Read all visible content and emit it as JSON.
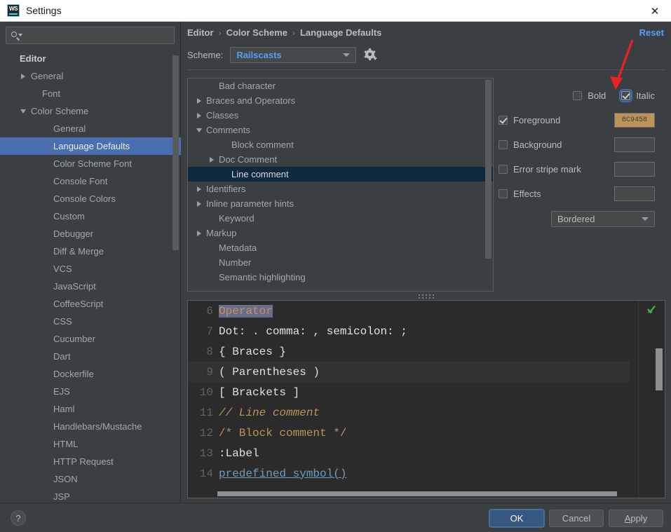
{
  "window": {
    "title": "Settings",
    "app_icon": "webstorm-logo-icon",
    "logo_text": "WS",
    "close_icon": "close-icon"
  },
  "sidebar": {
    "search": {
      "placeholder": "",
      "value": "",
      "icon": "search-icon"
    },
    "items": [
      {
        "label": "Editor",
        "indent": 0,
        "twisty": "none",
        "selected": false,
        "bold": true
      },
      {
        "label": "General",
        "indent": 1,
        "twisty": "right",
        "selected": false
      },
      {
        "label": "Font",
        "indent": 2,
        "twisty": "none",
        "selected": false
      },
      {
        "label": "Color Scheme",
        "indent": 1,
        "twisty": "down",
        "selected": false
      },
      {
        "label": "General",
        "indent": 3,
        "twisty": "none",
        "selected": false
      },
      {
        "label": "Language Defaults",
        "indent": 3,
        "twisty": "none",
        "selected": true
      },
      {
        "label": "Color Scheme Font",
        "indent": 3,
        "twisty": "none",
        "selected": false
      },
      {
        "label": "Console Font",
        "indent": 3,
        "twisty": "none",
        "selected": false
      },
      {
        "label": "Console Colors",
        "indent": 3,
        "twisty": "none",
        "selected": false
      },
      {
        "label": "Custom",
        "indent": 3,
        "twisty": "none",
        "selected": false
      },
      {
        "label": "Debugger",
        "indent": 3,
        "twisty": "none",
        "selected": false
      },
      {
        "label": "Diff & Merge",
        "indent": 3,
        "twisty": "none",
        "selected": false
      },
      {
        "label": "VCS",
        "indent": 3,
        "twisty": "none",
        "selected": false
      },
      {
        "label": "JavaScript",
        "indent": 3,
        "twisty": "none",
        "selected": false
      },
      {
        "label": "CoffeeScript",
        "indent": 3,
        "twisty": "none",
        "selected": false
      },
      {
        "label": "CSS",
        "indent": 3,
        "twisty": "none",
        "selected": false
      },
      {
        "label": "Cucumber",
        "indent": 3,
        "twisty": "none",
        "selected": false
      },
      {
        "label": "Dart",
        "indent": 3,
        "twisty": "none",
        "selected": false
      },
      {
        "label": "Dockerfile",
        "indent": 3,
        "twisty": "none",
        "selected": false
      },
      {
        "label": "EJS",
        "indent": 3,
        "twisty": "none",
        "selected": false
      },
      {
        "label": "Haml",
        "indent": 3,
        "twisty": "none",
        "selected": false
      },
      {
        "label": "Handlebars/Mustache",
        "indent": 3,
        "twisty": "none",
        "selected": false
      },
      {
        "label": "HTML",
        "indent": 3,
        "twisty": "none",
        "selected": false
      },
      {
        "label": "HTTP Request",
        "indent": 3,
        "twisty": "none",
        "selected": false
      },
      {
        "label": "JSON",
        "indent": 3,
        "twisty": "none",
        "selected": false
      },
      {
        "label": "JSP",
        "indent": 3,
        "twisty": "none",
        "selected": false
      }
    ]
  },
  "header": {
    "breadcrumb": [
      "Editor",
      "Color Scheme",
      "Language Defaults"
    ],
    "breadcrumb_separator": "›",
    "reset_label": "Reset",
    "scheme_label": "Scheme:",
    "scheme_value": "Railscasts",
    "scheme_settings_icon": "gear-icon"
  },
  "color_tree": {
    "items": [
      {
        "label": "Bad character",
        "indent": 1,
        "twisty": "none",
        "selected": false
      },
      {
        "label": "Braces and Operators",
        "indent": 0,
        "twisty": "right",
        "selected": false
      },
      {
        "label": "Classes",
        "indent": 0,
        "twisty": "right",
        "selected": false
      },
      {
        "label": "Comments",
        "indent": 0,
        "twisty": "down",
        "selected": false
      },
      {
        "label": "Block comment",
        "indent": 2,
        "twisty": "none",
        "selected": false
      },
      {
        "label": "Doc Comment",
        "indent": 1,
        "twisty": "right",
        "selected": false
      },
      {
        "label": "Line comment",
        "indent": 2,
        "twisty": "none",
        "selected": true
      },
      {
        "label": "Identifiers",
        "indent": 0,
        "twisty": "right",
        "selected": false
      },
      {
        "label": "Inline parameter hints",
        "indent": 0,
        "twisty": "right",
        "selected": false
      },
      {
        "label": "Keyword",
        "indent": 1,
        "twisty": "none",
        "selected": false
      },
      {
        "label": "Markup",
        "indent": 0,
        "twisty": "right",
        "selected": false
      },
      {
        "label": "Metadata",
        "indent": 1,
        "twisty": "none",
        "selected": false
      },
      {
        "label": "Number",
        "indent": 1,
        "twisty": "none",
        "selected": false
      },
      {
        "label": "Semantic highlighting",
        "indent": 1,
        "twisty": "none",
        "selected": false
      }
    ]
  },
  "attributes": {
    "bold": {
      "label": "Bold",
      "checked": false
    },
    "italic": {
      "label": "Italic",
      "checked": true,
      "focused": true
    },
    "foreground": {
      "label": "Foreground",
      "checked": true,
      "color": "#BC9458",
      "color_text": "BC9458"
    },
    "background": {
      "label": "Background",
      "checked": false,
      "color": ""
    },
    "error_stripe": {
      "label": "Error stripe mark",
      "checked": false,
      "color": ""
    },
    "effects": {
      "label": "Effects",
      "checked": false,
      "color": ""
    },
    "effect_type": {
      "value": "Bordered"
    }
  },
  "preview": {
    "lines": [
      {
        "num": "6",
        "highlighted": false,
        "tokens": [
          {
            "text": "Operator",
            "style": "sel"
          }
        ]
      },
      {
        "num": "7",
        "highlighted": false,
        "tokens": [
          {
            "text": "Dot: . comma: , semicolon: ;",
            "style": "def"
          }
        ]
      },
      {
        "num": "8",
        "highlighted": false,
        "tokens": [
          {
            "text": "{ Braces }",
            "style": "def"
          }
        ]
      },
      {
        "num": "9",
        "highlighted": true,
        "tokens": [
          {
            "text": "( Parentheses )",
            "style": "def"
          }
        ]
      },
      {
        "num": "10",
        "highlighted": false,
        "tokens": [
          {
            "text": "[ Brackets ]",
            "style": "def"
          }
        ]
      },
      {
        "num": "11",
        "highlighted": false,
        "tokens": [
          {
            "text": "// Line comment",
            "style": "comment"
          }
        ]
      },
      {
        "num": "12",
        "highlighted": false,
        "tokens": [
          {
            "text": "/* Block comment */",
            "style": "block"
          }
        ]
      },
      {
        "num": "13",
        "highlighted": false,
        "tokens": [
          {
            "text": ":Label",
            "style": "def"
          }
        ]
      },
      {
        "num": "14",
        "highlighted": false,
        "tokens": [
          {
            "text": "predefined_symbol()",
            "style": "predef"
          }
        ]
      }
    ],
    "inspection_icon": "inspection-ok-checkmark-icon"
  },
  "footer": {
    "help_label": "?",
    "ok_label": "OK",
    "cancel_label": "Cancel",
    "apply_label": "Apply",
    "apply_mnemonic": "A",
    "apply_rest": "pply"
  },
  "annotation": {
    "arrow_color": "#ED2024",
    "points_to": "italic-checkbox"
  },
  "colors": {
    "accent_blue": "#589df6",
    "selection_blue": "#4b6eaf",
    "tree_selection": "#0d293e",
    "panel_bg": "#3c3f41",
    "editor_bg": "#2b2b2b",
    "foreground_swatch": "#BC9458"
  }
}
